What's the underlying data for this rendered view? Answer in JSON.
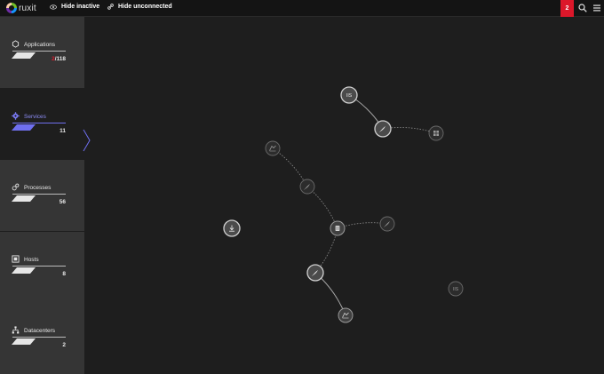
{
  "topbar": {
    "logo_text": "ruxit",
    "hide_inactive_label": "Hide inactive",
    "hide_unconnected_label": "Hide unconnected",
    "alert_count": "2"
  },
  "sidebar": {
    "tiles": [
      {
        "label": "Applications",
        "count_prefix": "2",
        "count_suffix": "/118",
        "active": false
      },
      {
        "label": "Services",
        "count": "11",
        "active": true
      },
      {
        "label": "Processes",
        "count": "56",
        "active": false
      },
      {
        "label": "Hosts",
        "count": "8",
        "active": false
      },
      {
        "label": "Datacenters",
        "count": "2",
        "active": false
      }
    ]
  },
  "colors": {
    "accent": "#6f6fef",
    "alert": "#dc172a",
    "tile_bg": "#353535",
    "canvas_bg": "#1e1e1e"
  },
  "graph": {
    "nodes": [
      {
        "id": "n1",
        "icon": "iis-icon",
        "glyph": "IIS",
        "style": "bright"
      },
      {
        "id": "n2",
        "icon": "feather-icon",
        "glyph": "",
        "style": "bright"
      },
      {
        "id": "n3",
        "icon": "windows-icon",
        "glyph": "",
        "style": "dim"
      },
      {
        "id": "n4",
        "icon": "server-cluster-icon",
        "glyph": "",
        "style": "dim"
      },
      {
        "id": "n5",
        "icon": "feather-icon",
        "glyph": "",
        "style": "dim"
      },
      {
        "id": "n6",
        "icon": "database-icon",
        "glyph": "",
        "style": "mid"
      },
      {
        "id": "n7",
        "icon": "feather-icon",
        "glyph": "",
        "style": "dim"
      },
      {
        "id": "n8",
        "icon": "download-icon",
        "glyph": "",
        "style": "bright"
      },
      {
        "id": "n9",
        "icon": "feather-icon",
        "glyph": "",
        "style": "bright"
      },
      {
        "id": "n10",
        "icon": "server-cluster-icon",
        "glyph": "",
        "style": "mid"
      },
      {
        "id": "n11",
        "icon": "iis-icon",
        "glyph": "IIS",
        "style": "dim"
      }
    ],
    "edges": [
      {
        "from": "n1",
        "to": "n2",
        "style": "solid"
      },
      {
        "from": "n2",
        "to": "n3",
        "style": "dashed"
      },
      {
        "from": "n4",
        "to": "n5",
        "style": "dashed"
      },
      {
        "from": "n5",
        "to": "n6",
        "style": "dashed"
      },
      {
        "from": "n6",
        "to": "n7",
        "style": "dashed"
      },
      {
        "from": "n6",
        "to": "n9",
        "style": "dashed"
      },
      {
        "from": "n9",
        "to": "n10",
        "style": "solid"
      }
    ]
  }
}
